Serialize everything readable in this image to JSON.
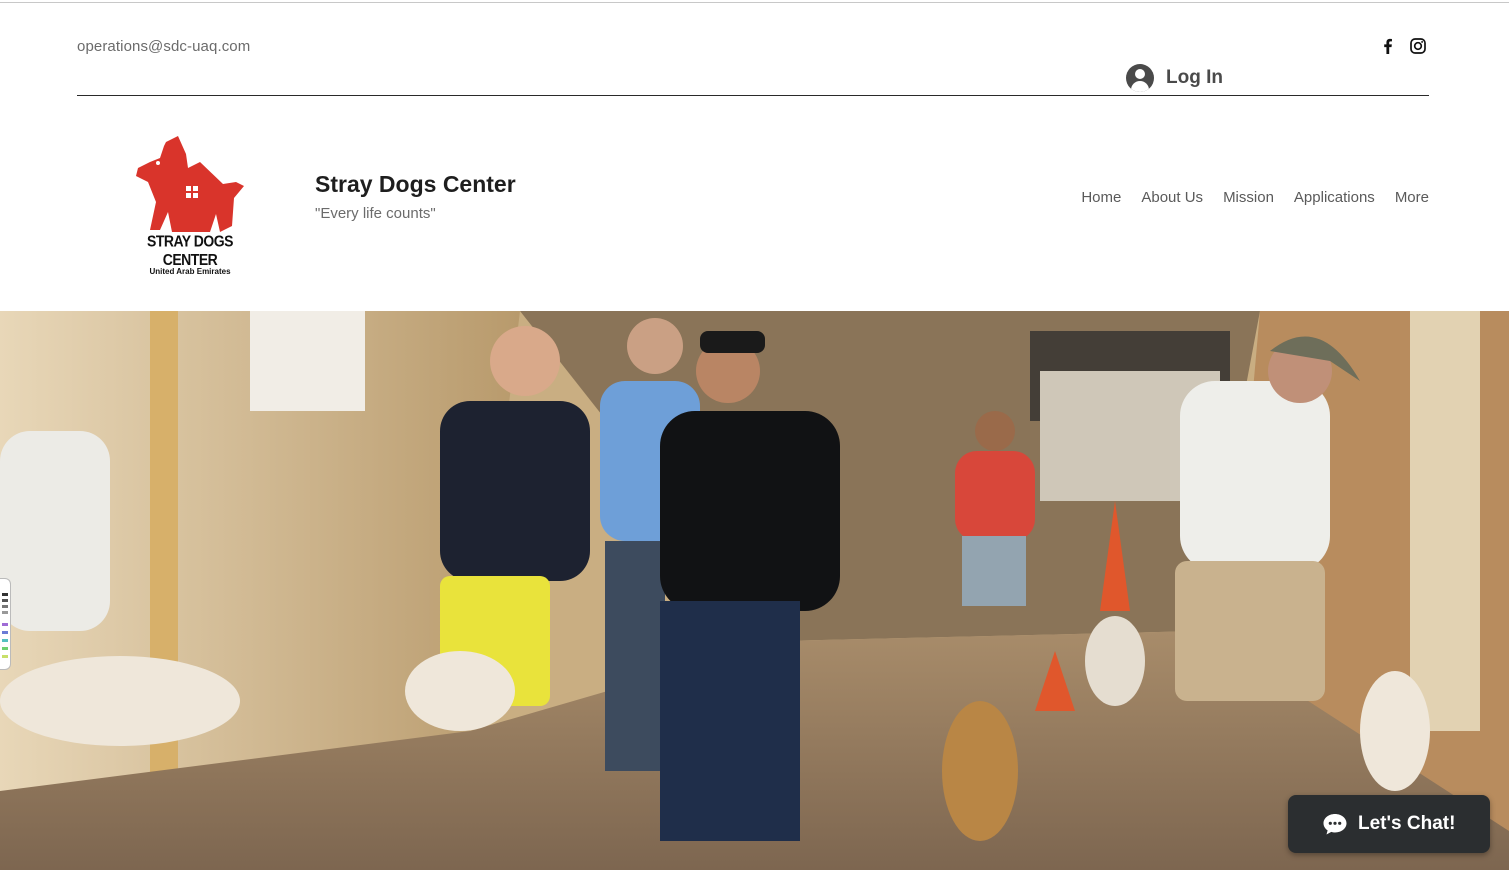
{
  "topbar": {
    "email": "operations@sdc-uaq.com",
    "social": [
      {
        "name": "facebook-icon"
      },
      {
        "name": "instagram-icon"
      }
    ],
    "login_label": "Log In"
  },
  "brand": {
    "logo_line1": "STRAY DOGS CENTER",
    "logo_line2": "United Arab Emirates",
    "title": "Stray Dogs Center",
    "tagline": "\"Every life counts\""
  },
  "nav": {
    "items": [
      "Home",
      "About Us",
      "Mission",
      "Applications",
      "More"
    ]
  },
  "chat": {
    "label": "Let's Chat!"
  },
  "colors": {
    "logo_red": "#d9342b",
    "chat_bg": "#2b2e30",
    "text_gray": "#6b6b6b"
  }
}
